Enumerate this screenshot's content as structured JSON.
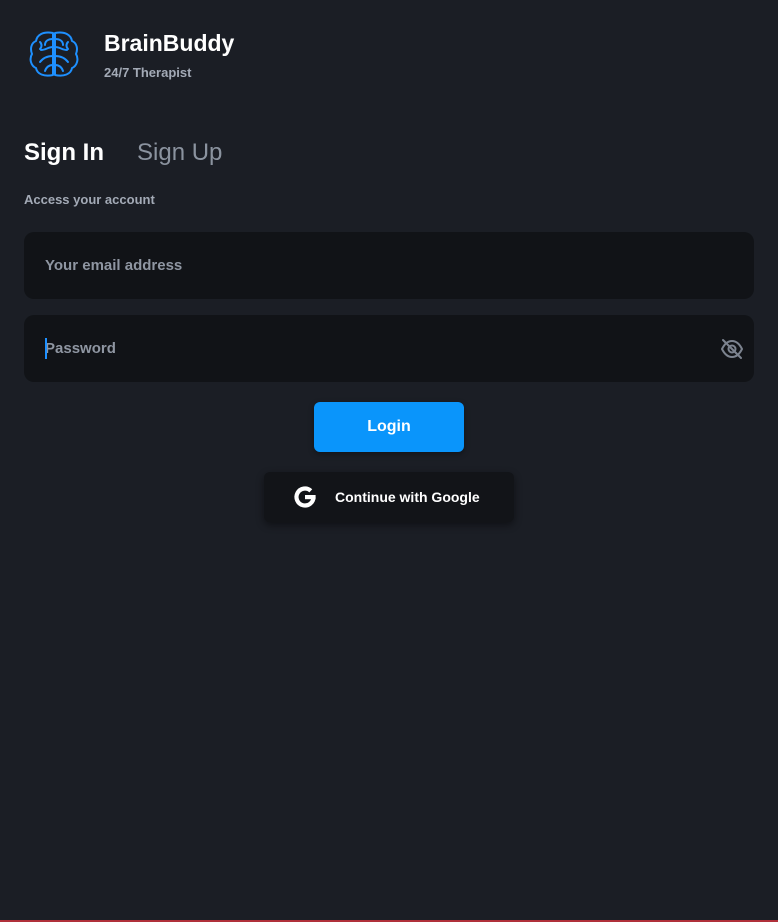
{
  "brand": {
    "name": "BrainBuddy",
    "tagline": "24/7 Therapist",
    "logo_icon": "brain-icon",
    "logo_color": "#1e90ff"
  },
  "tabs": {
    "sign_in": "Sign In",
    "sign_up": "Sign Up",
    "active": "sign_in"
  },
  "subtitle": "Access your account",
  "form": {
    "email_placeholder": "Your email address",
    "email_value": "",
    "password_placeholder": "Password",
    "password_value": "",
    "password_toggle_icon": "eye-off-icon"
  },
  "actions": {
    "login_label": "Login",
    "google_label": "Continue with Google",
    "google_icon": "google-g-icon"
  },
  "colors": {
    "background": "#1b1e25",
    "field_background": "#111317",
    "primary": "#0a95fb",
    "text_primary": "#ffffff",
    "text_secondary": "#a3aab6"
  }
}
